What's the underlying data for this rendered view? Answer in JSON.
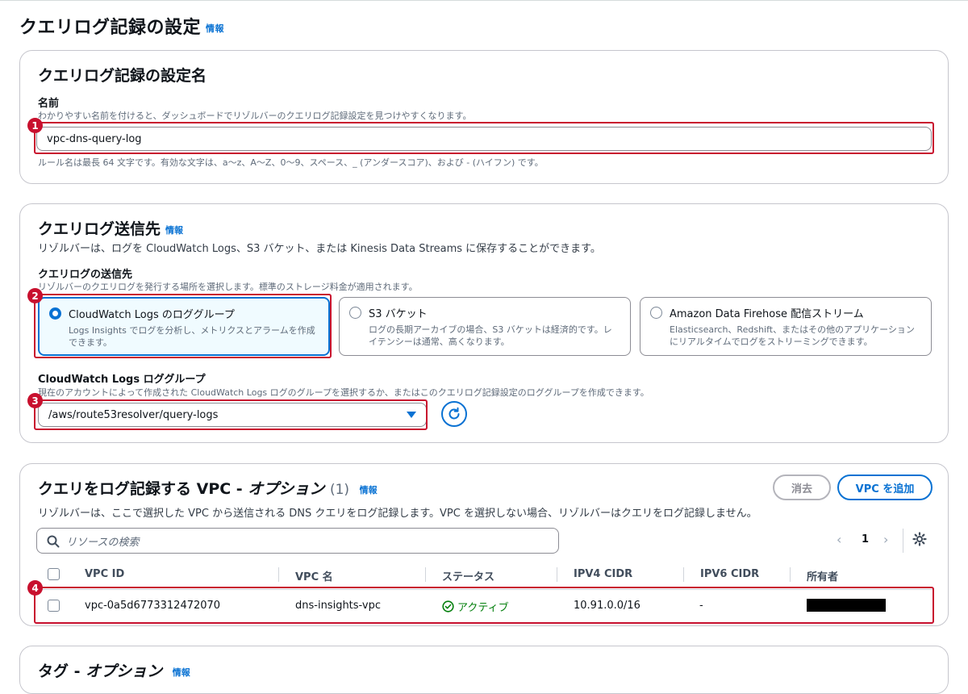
{
  "header": {
    "title": "クエリログ記録の設定",
    "info": "情報"
  },
  "name_section": {
    "title": "クエリログ記録の設定名",
    "field_label": "名前",
    "field_desc": "わかりやすい名前を付けると、ダッシュボードでリゾルバーのクエリログ記録設定を見つけやすくなります。",
    "value": "vpc-dns-query-log",
    "constraint": "ルール名は最長 64 文字です。有効な文字は、a〜z、A〜Z、0〜9、スペース、_ (アンダースコア)、および - (ハイフン) です。"
  },
  "destination_section": {
    "title": "クエリログ送信先",
    "info": "情報",
    "desc": "リゾルバーは、ログを CloudWatch Logs、S3 バケット、または Kinesis Data Streams に保存することができます。",
    "field_label": "クエリログの送信先",
    "field_desc": "リゾルバーのクエリログを発行する場所を選択します。標準のストレージ料金が適用されます。",
    "options": [
      {
        "title": "CloudWatch Logs のロググループ",
        "desc": "Logs Insights でログを分析し、メトリクスとアラームを作成できます。",
        "selected": true
      },
      {
        "title": "S3 バケット",
        "desc": "ログの長期アーカイブの場合、S3 バケットは経済的です。レイテンシーは通常、高くなります。",
        "selected": false
      },
      {
        "title": "Amazon Data Firehose 配信ストリーム",
        "desc": "Elasticsearch、Redshift、またはその他のアプリケーションにリアルタイムでログをストリーミングできます。",
        "selected": false
      }
    ],
    "loggroup_label": "CloudWatch Logs ロググループ",
    "loggroup_desc": "現在のアカウントによって作成された CloudWatch Logs ログのグループを選択するか、またはこのクエリログ記録設定のロググループを作成できます。",
    "loggroup_value": "/aws/route53resolver/query-logs"
  },
  "vpc_section": {
    "title": "クエリをログ記録する VPC - ",
    "title_italic": "オプション",
    "count": "(1)",
    "info": "情報",
    "clear_button": "消去",
    "add_button": "VPC を追加",
    "desc": "リゾルバーは、ここで選択した VPC から送信される DNS クエリをログ記録します。VPC を選択しない場合、リゾルバーはクエリをログ記録しません。",
    "search_placeholder": "リソースの検索",
    "page": "1",
    "columns": [
      "VPC ID",
      "VPC 名",
      "ステータス",
      "IPV4 CIDR",
      "IPV6 CIDR",
      "所有者"
    ],
    "rows": [
      {
        "vpc_id": "vpc-0a5d6773312472070",
        "vpc_name": "dns-insights-vpc",
        "status": "アクティブ",
        "ipv4": "10.91.0.0/16",
        "ipv6": "-"
      }
    ]
  },
  "tags_section": {
    "title": "タグ - ",
    "title_italic": "オプション",
    "info": "情報"
  },
  "annotations": [
    "1",
    "2",
    "3",
    "4"
  ],
  "colors": {
    "accent": "#0972d3",
    "highlight": "#c8102e",
    "success": "#037f0c"
  }
}
